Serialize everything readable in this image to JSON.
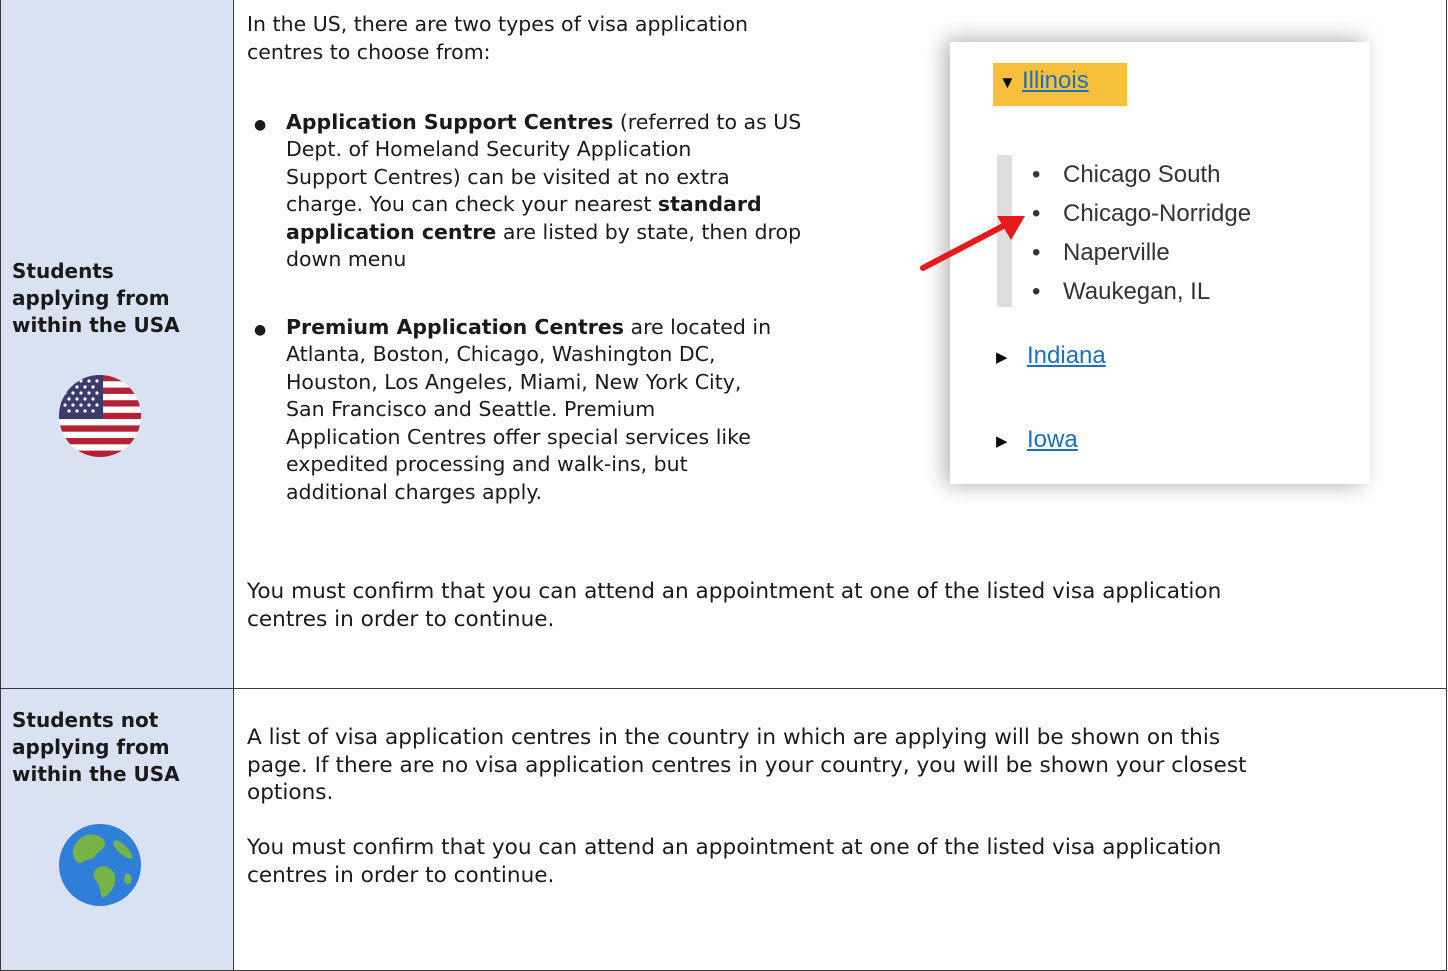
{
  "rows": [
    {
      "label": [
        "Students",
        "applying from",
        "within the USA"
      ],
      "flag_icon": "us-flag-icon",
      "intro": [
        "In the US, there are two types of visa application",
        "centres to choose from:"
      ],
      "bullet1": {
        "bold": "Application Support Centres",
        "rest": " (referred to as US",
        "lines": [
          "Dept. of Homeland Security Application",
          "Support Centres) can be visited at no extra",
          "charge. You can check your nearest "
        ],
        "bold2a": "standard",
        "bold2b": "application centre",
        "tail": " are listed by state, then drop",
        "last": "down menu"
      },
      "bullet2": {
        "bold": "Premium Application Centres",
        "rest": " are located in",
        "lines": [
          "Atlanta, Boston, Chicago, Washington DC,",
          "Houston, Los Angeles, Miami, New York City,",
          "San Francisco and Seattle. Premium",
          "Application Centres offer special services like",
          "expedited processing and walk-ins, but",
          "additional charges apply."
        ]
      },
      "confirm": [
        "You must confirm that you can attend an appointment at one of the listed visa application",
        "centres in order to continue."
      ]
    },
    {
      "label": [
        "Students not",
        "applying from",
        "within the USA"
      ],
      "globe_icon": "globe-icon",
      "para1": [
        "A list of visa application centres in the country in which are applying will be shown on this",
        "page. If there are no visa application centres in your country, you will be shown your closest",
        "options."
      ],
      "confirm": [
        "You must confirm that you can attend an appointment at one of the listed visa application",
        "centres in order to continue."
      ]
    }
  ],
  "inset": {
    "expanded_state": "Illinois",
    "centres": [
      "Chicago South",
      "Chicago-Norridge",
      "Naperville",
      "Waukegan, IL"
    ],
    "collapsed_states": [
      "Indiana",
      "Iowa"
    ],
    "highlight_color": "#f8bf3a",
    "link_color": "#1d70b8",
    "arrow_color": "#e8191a"
  }
}
